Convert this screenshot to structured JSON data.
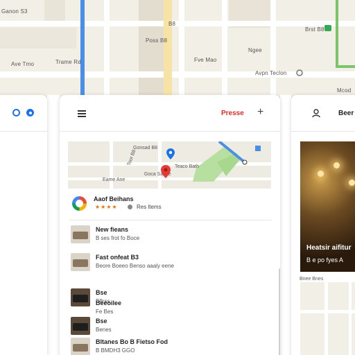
{
  "map_labels": [
    "Ganon S3",
    "B8",
    "Trame Rd",
    "Ngee",
    "Avpn Teclon",
    "Poss B8",
    "Ave Tmo",
    "Fve Mao",
    "Brst B8",
    "Mcod"
  ],
  "left_card": {},
  "main_card": {
    "header_link": "Presse",
    "header_plus": "+",
    "mini_map_labels": [
      "Gonsad B8",
      "Toor B8",
      "Teaco Bath",
      "Goca Sacae",
      "Eame Ane"
    ],
    "place": {
      "name": "Aaof Beihans",
      "stars": "★★★★",
      "meta": "Res ltems"
    },
    "list": [
      {
        "title": "New fieans",
        "sub": "B ses frot fo Boce"
      },
      {
        "title": "Fast onfeat B3",
        "sub": "Beore Boeeo Benso aaaly eene"
      },
      {
        "title": "Bse",
        "sub": "B8rss"
      },
      {
        "title": "Beeoilee",
        "sub": "Fe Bes"
      },
      {
        "title": "Bse",
        "sub": "Benes"
      },
      {
        "title": "Bltanes Bo B Fietso Fod",
        "sub": "B BMDH3 GGO"
      }
    ]
  },
  "right_card": {
    "title": "Beer",
    "photo_title": "Heatsir aifitur",
    "photo_sub": "B e po fyes A",
    "label": "Bnee Bnes"
  }
}
